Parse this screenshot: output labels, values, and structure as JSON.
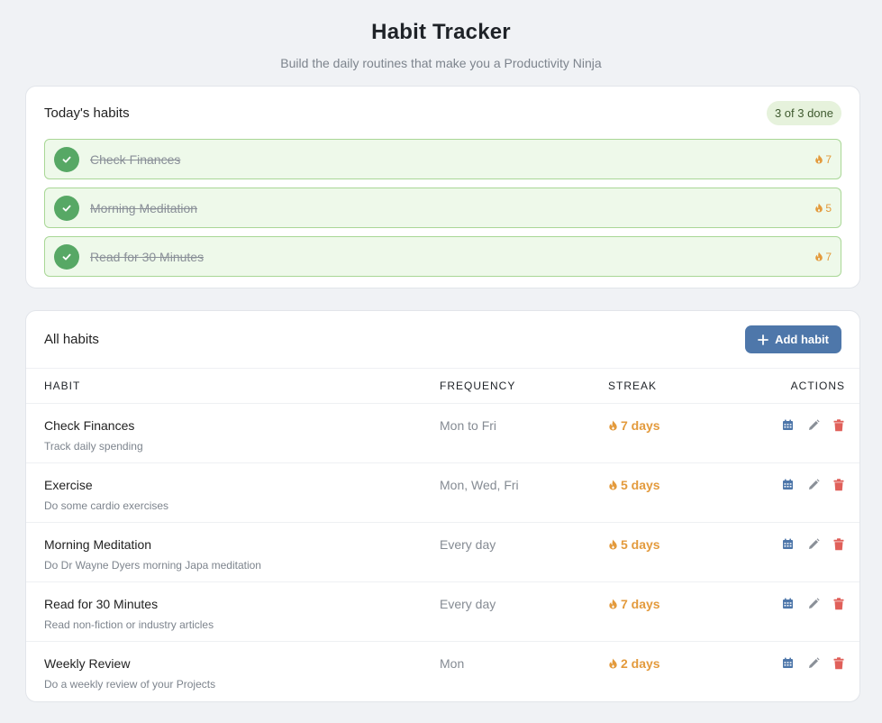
{
  "header": {
    "title": "Habit Tracker",
    "subtitle": "Build the daily routines that make you a Productivity Ninja"
  },
  "today": {
    "title": "Today's habits",
    "badge": "3 of 3 done",
    "items": [
      {
        "name": "Check Finances",
        "streak": "7"
      },
      {
        "name": "Morning Meditation",
        "streak": "5"
      },
      {
        "name": "Read for 30 Minutes",
        "streak": "7"
      }
    ]
  },
  "all": {
    "title": "All habits",
    "add_label": "Add habit",
    "columns": {
      "habit": "HABIT",
      "frequency": "FREQUENCY",
      "streak": "STREAK",
      "actions": "ACTIONS"
    },
    "rows": [
      {
        "name": "Check Finances",
        "desc": "Track daily spending",
        "frequency": "Mon to Fri",
        "streak": "7 days"
      },
      {
        "name": "Exercise",
        "desc": "Do some cardio exercises",
        "frequency": "Mon, Wed, Fri",
        "streak": "5 days"
      },
      {
        "name": "Morning Meditation",
        "desc": "Do Dr Wayne Dyers morning Japa meditation",
        "frequency": "Every day",
        "streak": "5 days"
      },
      {
        "name": "Read for 30 Minutes",
        "desc": "Read non-fiction or industry articles",
        "frequency": "Every day",
        "streak": "7 days"
      },
      {
        "name": "Weekly Review",
        "desc": "Do a weekly review of your Projects",
        "frequency": "Mon",
        "streak": "2 days"
      }
    ]
  },
  "icons": {
    "check": "check-icon",
    "flame": "flame-icon",
    "plus": "plus-icon",
    "calendar": "calendar-icon",
    "edit": "pencil-icon",
    "delete": "trash-icon"
  },
  "colors": {
    "accent": "#4e77aa",
    "success": "#57a865",
    "streak": "#e39a3c",
    "danger": "#e0605a"
  }
}
